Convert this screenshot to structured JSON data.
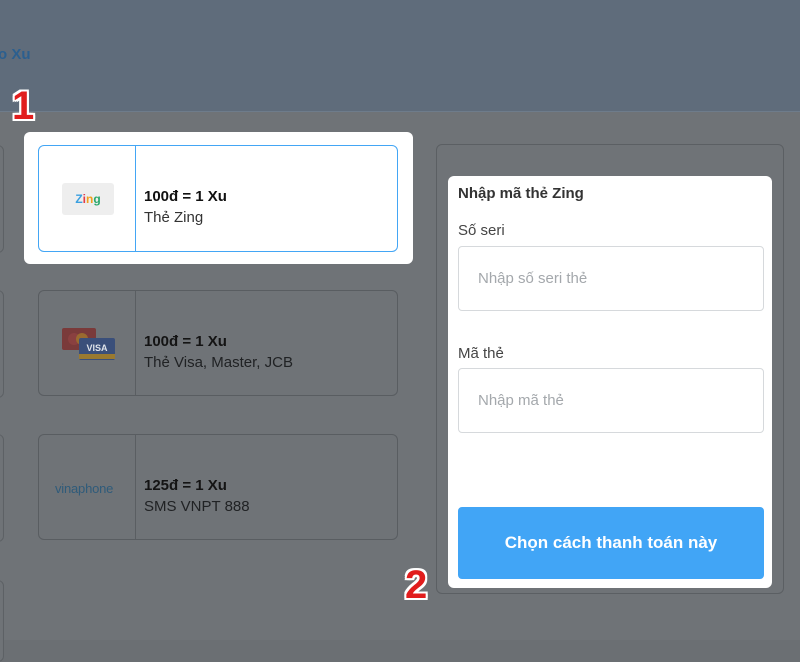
{
  "header": {
    "title_fragment": "o Xu"
  },
  "cards": [
    {
      "price": "100đ = 1 Xu",
      "name": "Thẻ Zing",
      "logo": "Zing",
      "selected": true
    },
    {
      "price": "100đ = 1 Xu",
      "name": "Thẻ Visa, Master, JCB",
      "logo": "VISA",
      "selected": false
    },
    {
      "price": "125đ = 1 Xu",
      "name": "SMS VNPT 888",
      "logo": "vinaphone",
      "selected": false
    }
  ],
  "form": {
    "title": "Nhập mã thẻ Zing",
    "serial_label": "Số seri",
    "serial_placeholder": "Nhập số seri thẻ",
    "code_label": "Mã thẻ",
    "code_placeholder": "Nhập mã thẻ",
    "submit_label": "Chọn cách thanh toán này"
  },
  "annotations": {
    "step1": "1",
    "step2": "2"
  },
  "colors": {
    "accent": "#41a5f6",
    "annotation": "#e11d1d",
    "overlay": "#6f7377"
  }
}
